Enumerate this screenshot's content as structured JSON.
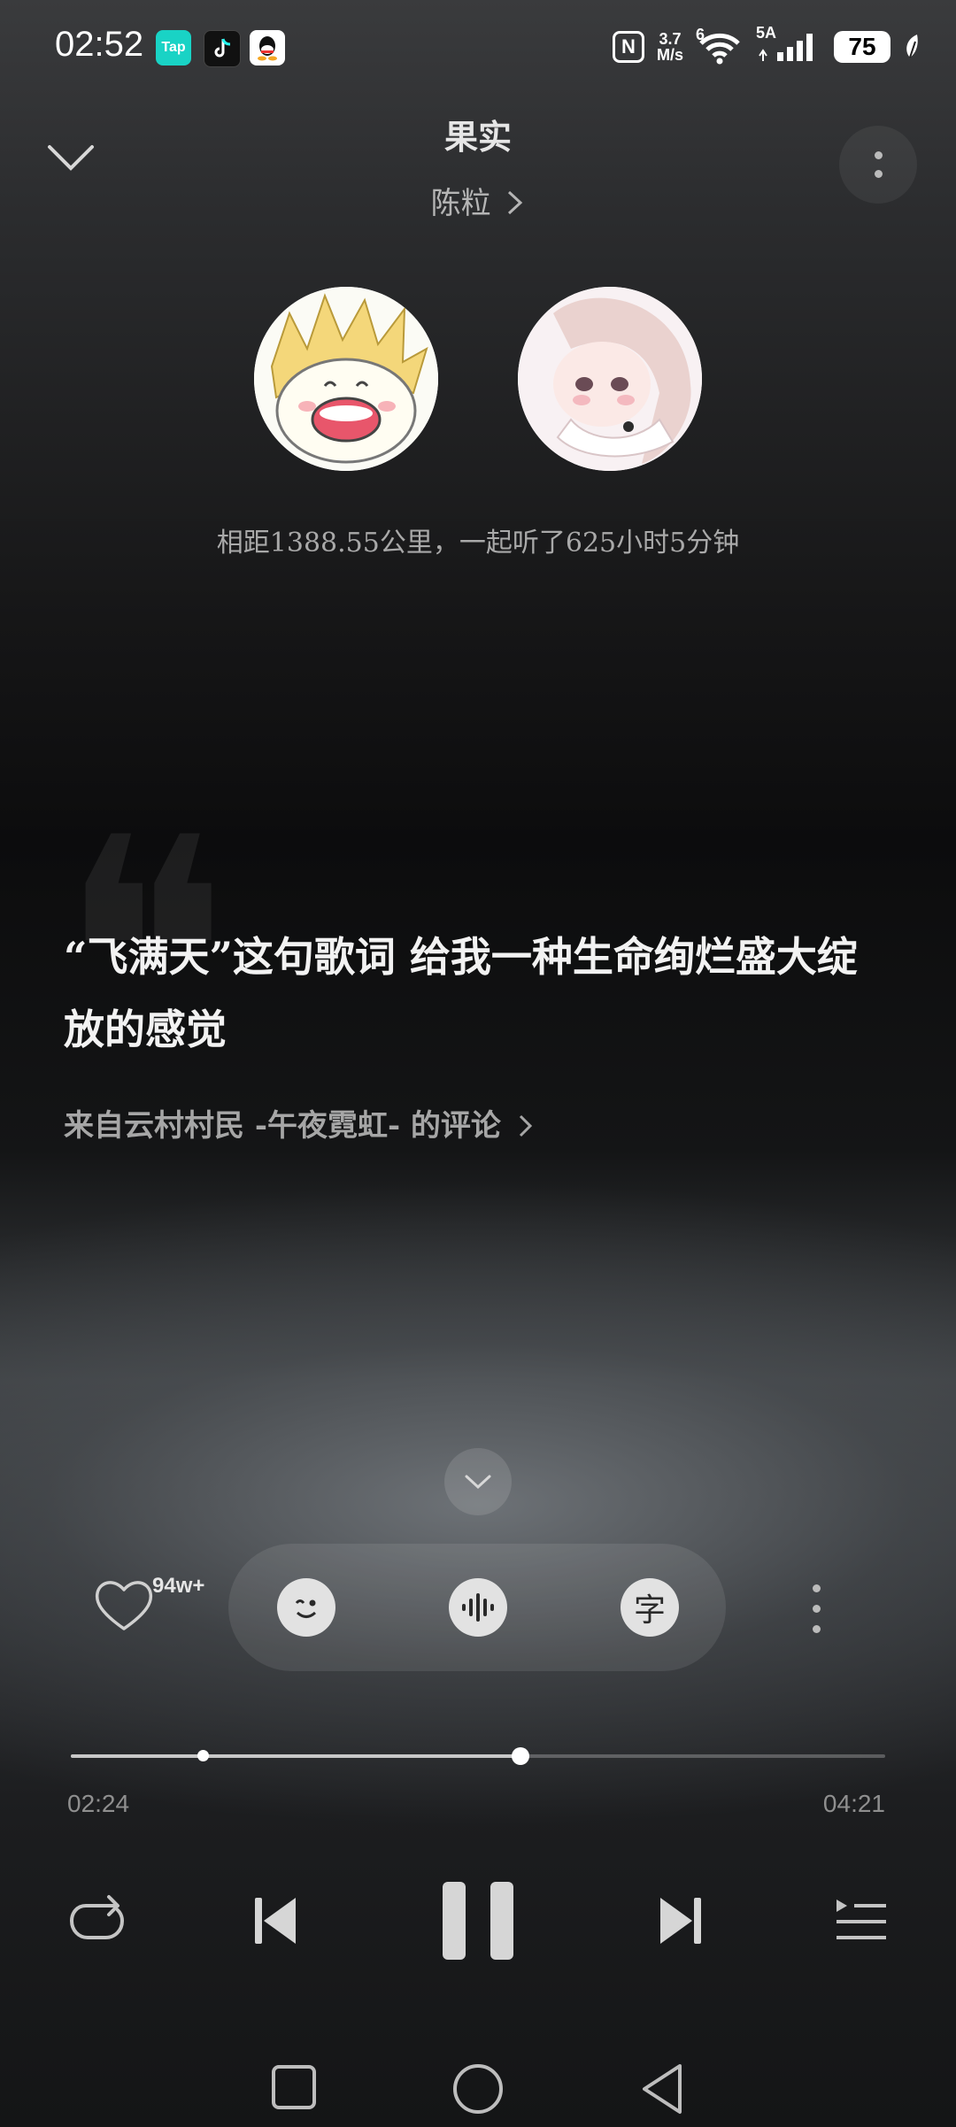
{
  "status_bar": {
    "time": "02:52",
    "apps": [
      "Tap",
      "TikTok",
      "QQ"
    ],
    "nfc": "N",
    "net_speed_value": "3.7",
    "net_speed_unit": "M/s",
    "wifi_label": "6",
    "signal_label": "5A",
    "battery": "75"
  },
  "header": {
    "title": "果实",
    "artist": "陈粒",
    "artist_chevron": "›"
  },
  "together": {
    "distance_text": "相距1388.55公里，一起听了625小时5分钟"
  },
  "comment": {
    "text": "“飞满天”这句歌词 给我一种生命绚烂盛大绽放的感觉",
    "source": "来自云村村民 -午夜霓虹- 的评论"
  },
  "actions": {
    "like_count": "94w+",
    "lyric_char": "字"
  },
  "progress": {
    "current": "02:24",
    "total": "04:21",
    "played_fraction": 0.552,
    "buffered_marker_fraction": 0.162
  },
  "colors": {
    "accent": "#ffffff",
    "muted_text": "#a6a6a6"
  }
}
